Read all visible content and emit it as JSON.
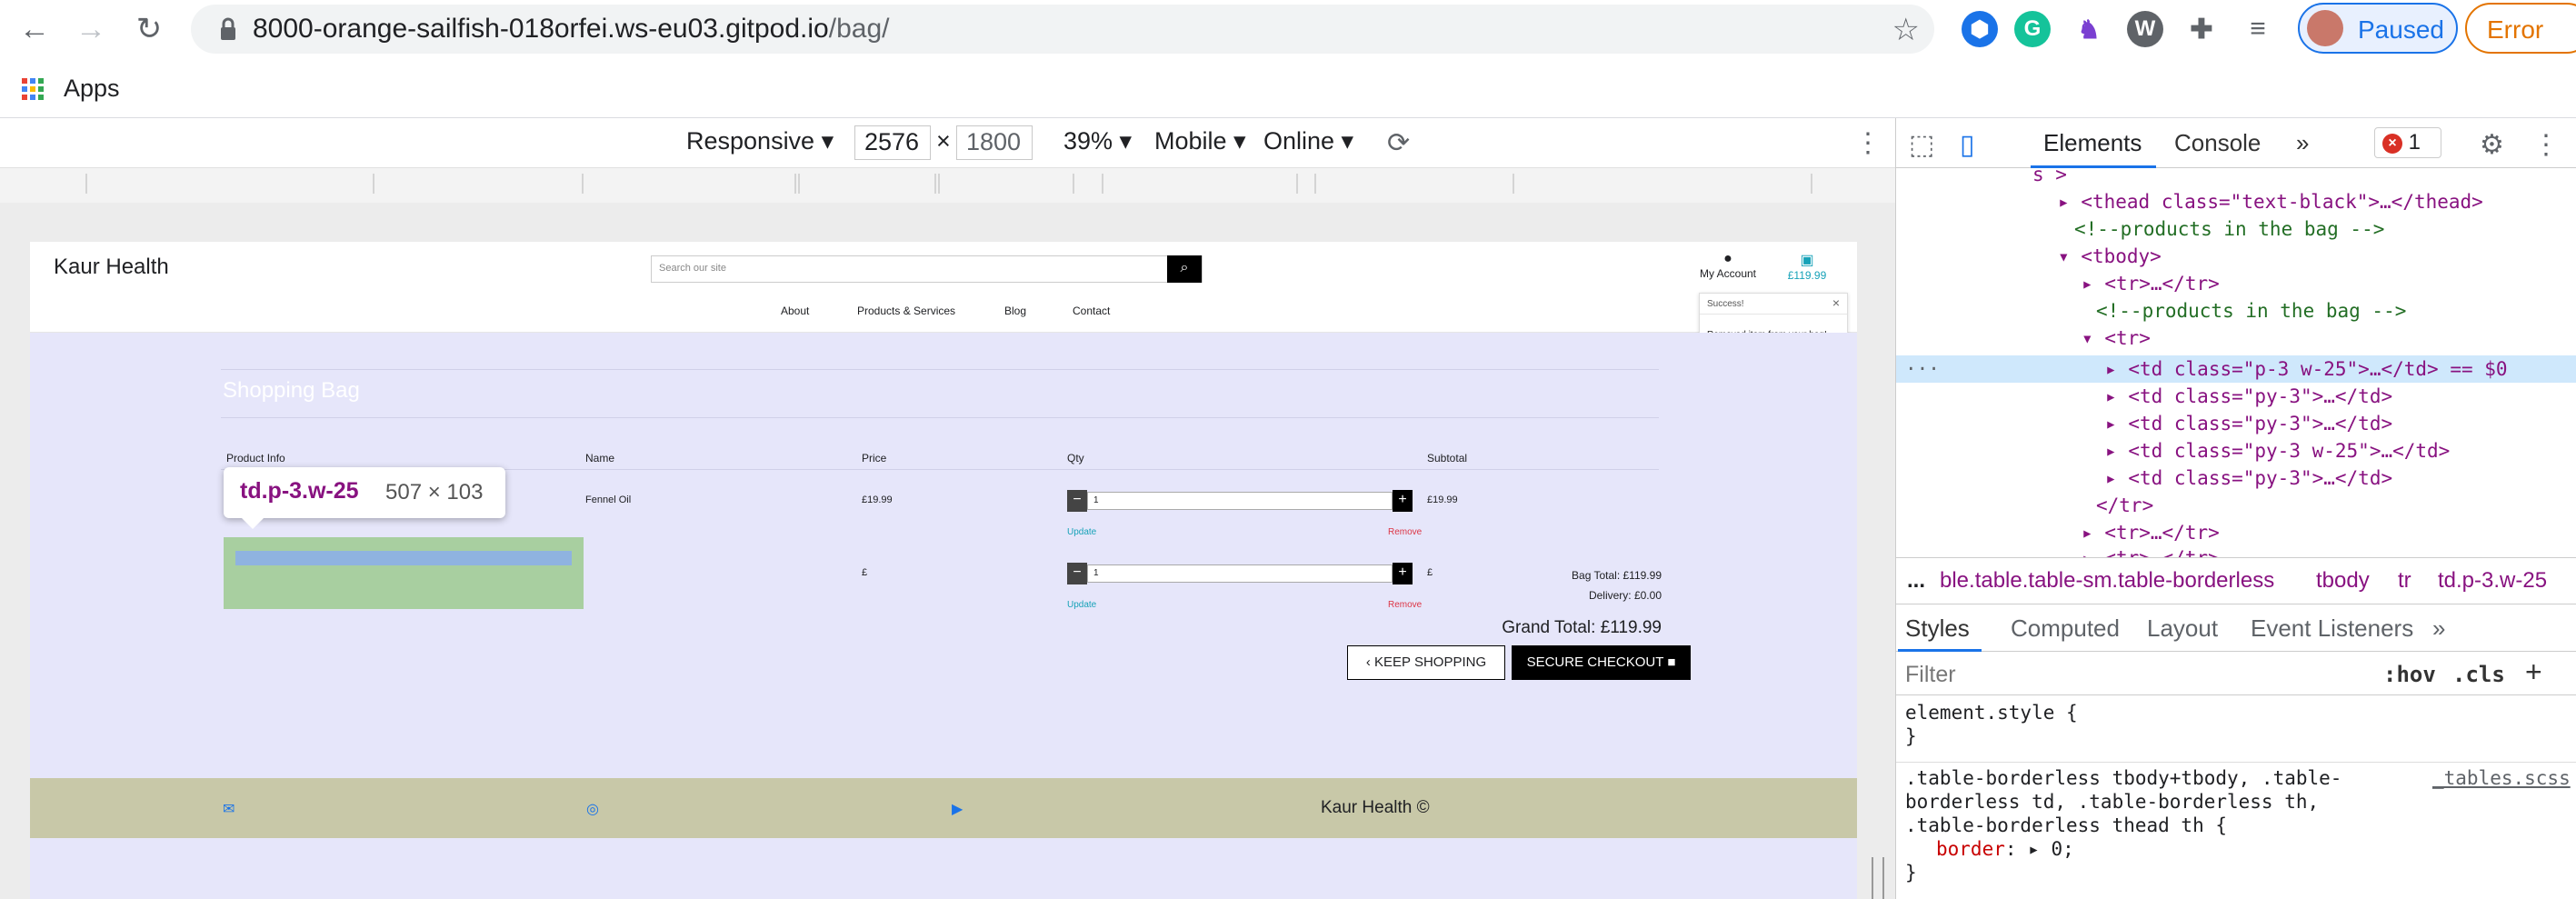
{
  "browser": {
    "url_host": "8000-orange-sailfish-018orfei.ws-eu03.gitpod.io",
    "url_path": "/bag/",
    "profile_label": "Paused",
    "error_label": "Error",
    "bookmarks": {
      "apps_label": "Apps"
    },
    "icons": [
      "back-icon",
      "forward-icon",
      "reload-icon",
      "lock-icon",
      "star-icon",
      "extensions-icon",
      "media-icon"
    ]
  },
  "device_toolbar": {
    "mode": "Responsive",
    "width": "2576",
    "times": "×",
    "height": "1800",
    "zoom": "39%",
    "device": "Mobile",
    "network": "Online"
  },
  "site": {
    "logo": "Kaur Health",
    "search_placeholder": "Search our site",
    "account_label": "My Account",
    "bag_total": "£119.99",
    "nav": [
      "About",
      "Products & Services",
      "Blog",
      "Contact"
    ],
    "toast": {
      "title": "Success!",
      "message": "Removed item from your bag!"
    },
    "bag_title": "Shopping Bag",
    "headers": {
      "product": "Product Info",
      "name": "Name",
      "price": "Price",
      "qty": "Qty",
      "subtotal": "Subtotal"
    },
    "rows": [
      {
        "name": "Fennel Oil",
        "price": "£19.99",
        "qty": "1",
        "subtotal": "£19.99",
        "update": "Update",
        "remove": "Remove"
      },
      {
        "name": "",
        "price": "£",
        "qty": "1",
        "subtotal": "£",
        "update": "Update",
        "remove": "Remove"
      }
    ],
    "bag_total_line": "Bag Total: £119.99",
    "delivery_line": "Delivery: £0.00",
    "grand_total": "Grand Total: £119.99",
    "keep_shopping": "KEEP SHOPPING",
    "secure_checkout": "SECURE CHECKOUT",
    "footer_copy": "Kaur Health ©"
  },
  "inspect_tooltip": {
    "selector": "td.p-3.w-25",
    "size": "507 × 103"
  },
  "devtools": {
    "tabs": [
      "Elements",
      "Console"
    ],
    "error_count": "1",
    "dom_lines": [
      "s >",
      "<thead class=\"text-black\">…</thead>",
      "<!--products in the bag -->",
      "<tbody>",
      "<tr>…</tr>",
      "<!--products in the bag -->",
      "<tr>",
      "<td class=\"p-3 w-25\">…</td> == $0",
      "<td class=\"py-3\">…</td>",
      "<td class=\"py-3\">…</td>",
      "<td class=\"py-3 w-25\">…</td>",
      "<td class=\"py-3\">…</td>",
      "</tr>",
      "<tr>…</tr>",
      "<tr>…</tr>"
    ],
    "breadcrumbs": [
      "...",
      "ble.table.table-sm.table-borderless",
      "tbody",
      "tr",
      "td.p-3.w-25"
    ],
    "style_tabs": [
      "Styles",
      "Computed",
      "Layout",
      "Event Listeners"
    ],
    "filter_placeholder": "Filter",
    "hov": ":hov",
    "cls": ".cls",
    "css": {
      "element_style": "element.style {",
      "close": "}",
      "rule_selector_1": ".table-borderless tbody+tbody, .table-",
      "rule_selector_2": "borderless td, .table-borderless th,",
      "rule_selector_3": ".table-borderless thead th {",
      "source": "_tables.scss",
      "property": "border",
      "value": "0;"
    }
  }
}
